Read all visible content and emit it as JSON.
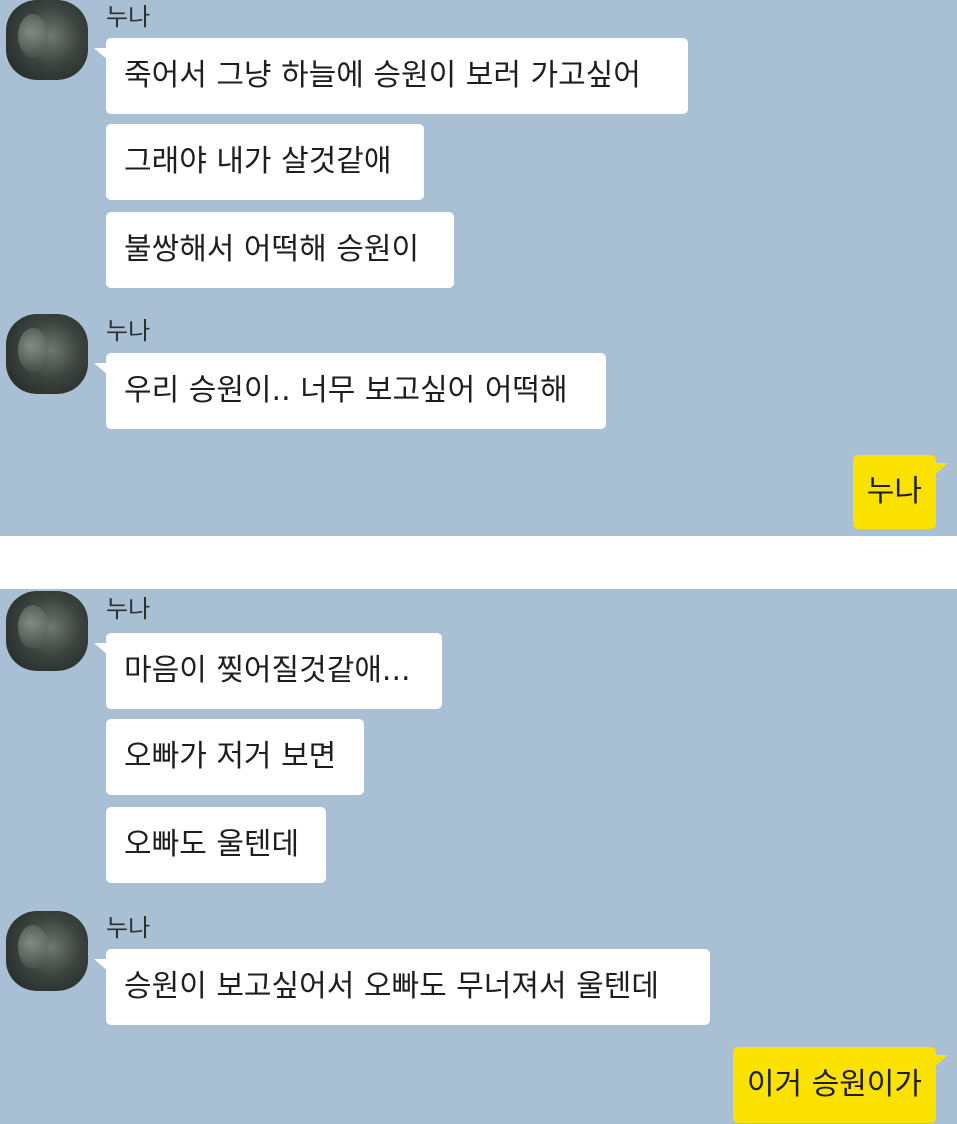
{
  "panel_1": {
    "group_1": {
      "sender": "누나",
      "messages": [
        "죽어서 그냥 하늘에 승원이 보러 가고싶어",
        "그래야 내가 살것같애",
        "불쌍해서 어떡해 승원이"
      ]
    },
    "group_2": {
      "sender": "누나",
      "messages": [
        "우리 승원이.. 너무 보고싶어 어떡해"
      ]
    },
    "sent": "누나"
  },
  "panel_2": {
    "group_1": {
      "sender": "누나",
      "messages": [
        "마음이 찢어질것같애...",
        "오빠가 저거 보면",
        "오빠도 울텐데"
      ]
    },
    "group_2": {
      "sender": "누나",
      "messages": [
        "승원이 보고싶어서 오빠도 무너져서 울텐데"
      ]
    },
    "sent": "이거 승원이가"
  },
  "colors": {
    "chat_background": "#a9bfd3",
    "received_bubble": "#ffffff",
    "sent_bubble": "#fae100"
  }
}
